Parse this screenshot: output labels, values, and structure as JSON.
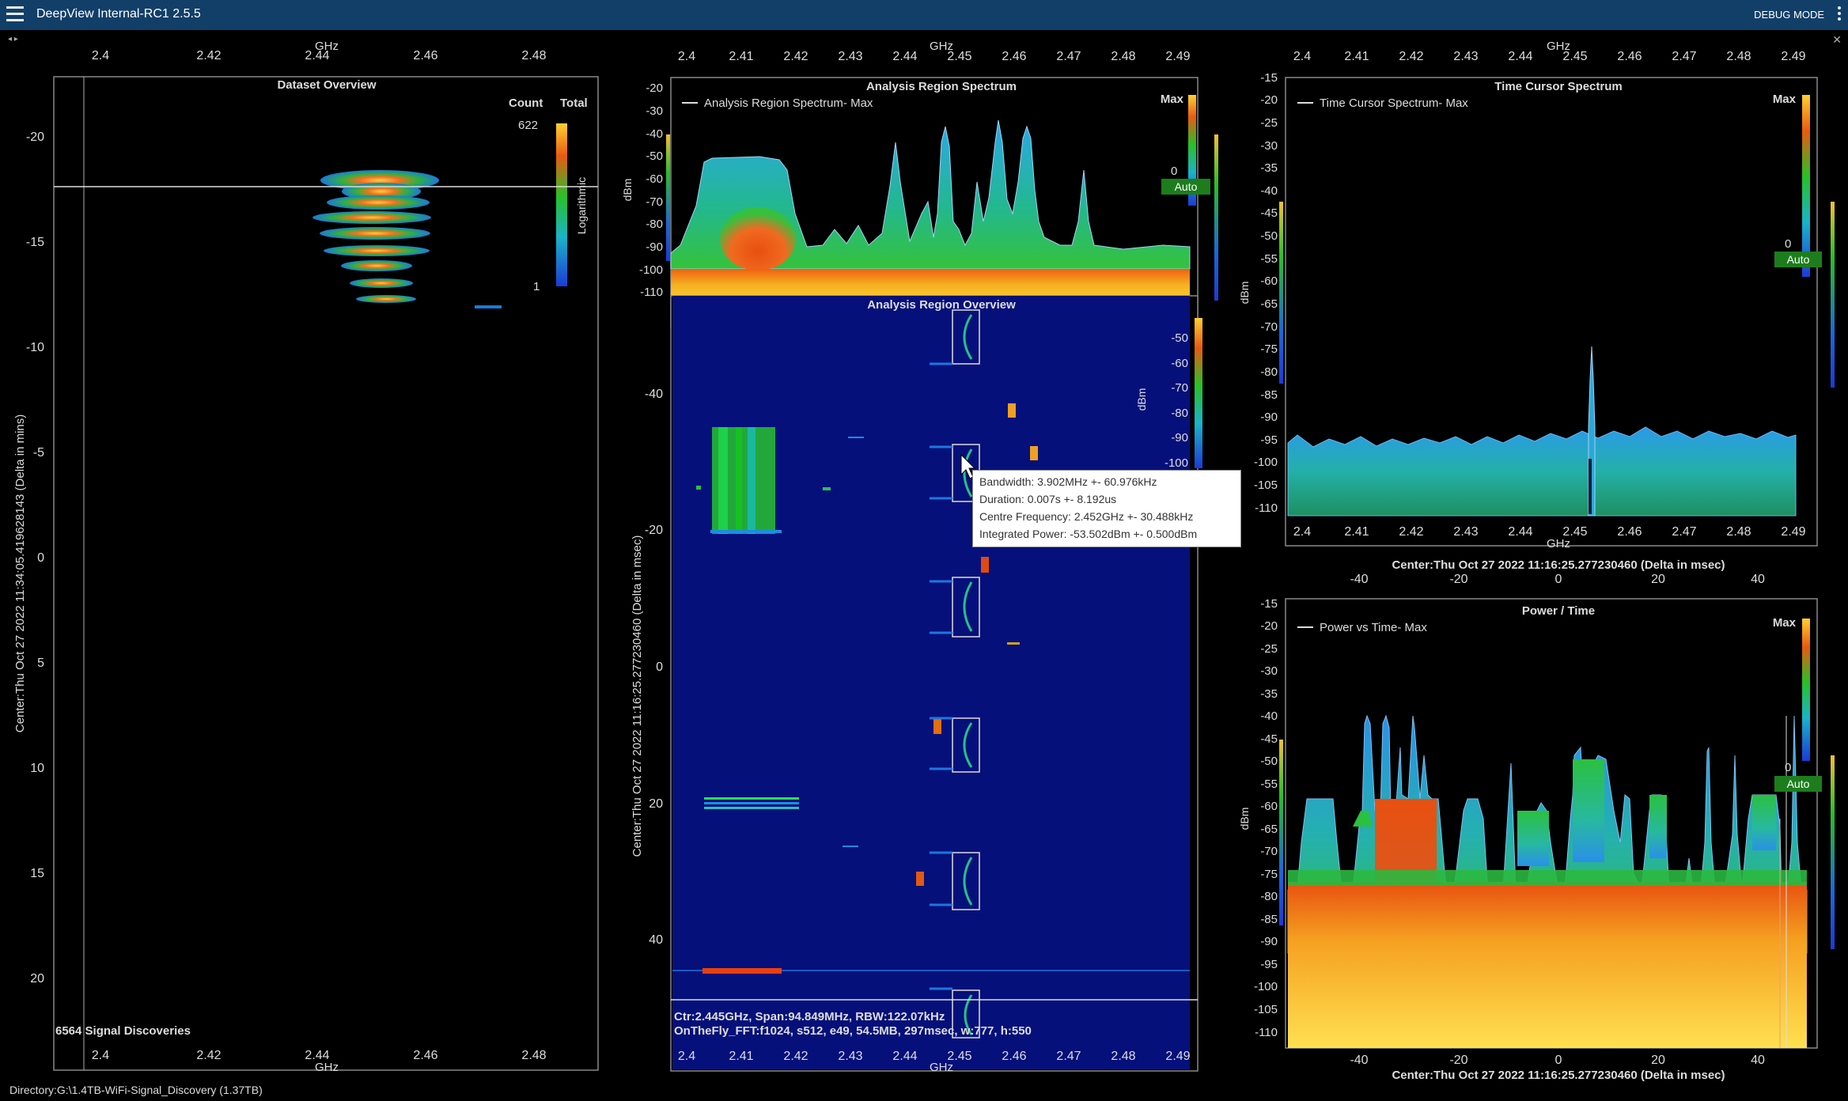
{
  "app": {
    "title": "DeepView Internal-RC1 2.5.5",
    "debug": "DEBUG MODE",
    "nav": "◂ ▸",
    "close": "✕"
  },
  "status": {
    "directory": "Directory:G:\\1.4TB-WiFi-Signal_Discovery (1.37TB)"
  },
  "dataset": {
    "title": "Dataset Overview",
    "xunit": "GHz",
    "xticks": [
      "2.4",
      "2.42",
      "2.44",
      "2.46",
      "2.48"
    ],
    "yticks": [
      "-20",
      "-15",
      "-10",
      "-5",
      "0",
      "5",
      "10",
      "15",
      "20"
    ],
    "ylabel": "Center:Thu Oct 27 2022 11:34:05.419628143 (Delta in mins)",
    "count_label": "Count",
    "total_label": "Total",
    "scale_max": "622",
    "scale_min": "1",
    "scale_label": "Logarithmic",
    "discoveries": "6564 Signal Discoveries"
  },
  "ars": {
    "title": "Analysis Region Spectrum",
    "legend": "Analysis Region Spectrum- Max",
    "yunit": "dBm",
    "yticks": [
      "-20",
      "-30",
      "-40",
      "-50",
      "-60",
      "-70",
      "-80",
      "-90",
      "-100",
      "-110"
    ],
    "max_label": "Max",
    "zero_label": "0",
    "auto": "Auto"
  },
  "aro": {
    "title": "Analysis Region Overview",
    "xunit": "GHz",
    "xticks": [
      "2.4",
      "2.41",
      "2.42",
      "2.43",
      "2.44",
      "2.45",
      "2.46",
      "2.47",
      "2.48",
      "2.49"
    ],
    "yticks": [
      "-40",
      "-20",
      "0",
      "20",
      "40"
    ],
    "ylabel": "Center:Thu Oct 27 2022 11:16:25.277230460 (Delta in msec)",
    "cticks": [
      "-50",
      "-60",
      "-70",
      "-80",
      "-90",
      "-100"
    ],
    "cunit": "dBm",
    "info1": "Ctr:2.445GHz, Span:94.849MHz, RBW:122.07kHz",
    "info2": "OnTheFly_FFT:f1024, s512, e49, 54.5MB, 297msec, w:777, h:550"
  },
  "tooltip": {
    "bandwidth": "Bandwidth: 3.902MHz +- 60.976kHz",
    "duration": "Duration: 0.007s +- 8.192us",
    "centre": "Centre Frequency: 2.452GHz +- 30.488kHz",
    "power": "Integrated Power: -53.502dBm +- 0.500dBm"
  },
  "tcs": {
    "title": "Time Cursor Spectrum",
    "legend": "Time Cursor Spectrum- Max",
    "xunit": "GHz",
    "xticks": [
      "2.4",
      "2.41",
      "2.42",
      "2.43",
      "2.44",
      "2.45",
      "2.46",
      "2.47",
      "2.48",
      "2.49"
    ],
    "yunit": "dBm",
    "yticks": [
      "-15",
      "-20",
      "-25",
      "-30",
      "-35",
      "-40",
      "-45",
      "-50",
      "-55",
      "-60",
      "-65",
      "-70",
      "-75",
      "-80",
      "-85",
      "-90",
      "-95",
      "-100",
      "-105",
      "-110"
    ],
    "max_label": "Max",
    "zero_label": "0",
    "auto": "Auto"
  },
  "pt": {
    "title": "Power / Time",
    "legend": "Power vs Time- Max",
    "center_label": "Center:Thu Oct 27 2022 11:16:25.277230460 (Delta in msec)",
    "xticks": [
      "-40",
      "-20",
      "0",
      "20",
      "40"
    ],
    "yunit": "dBm",
    "yticks": [
      "-15",
      "-20",
      "-25",
      "-30",
      "-35",
      "-40",
      "-45",
      "-50",
      "-55",
      "-60",
      "-65",
      "-70",
      "-75",
      "-80",
      "-85",
      "-90",
      "-95",
      "-100",
      "-105",
      "-110"
    ],
    "max_label": "Max",
    "zero_label": "0",
    "auto": "Auto"
  }
}
